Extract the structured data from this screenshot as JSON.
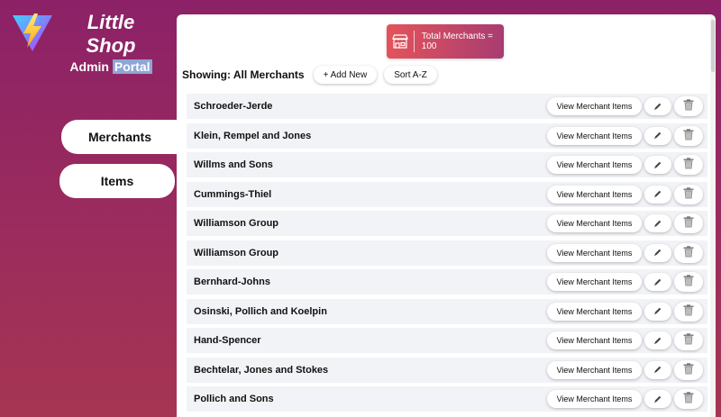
{
  "brand": {
    "title_line1": "Little",
    "title_line2": "Shop",
    "subtitle_part1": "Admin",
    "subtitle_part2": "Portal"
  },
  "nav": {
    "items": [
      {
        "label": "Merchants",
        "active": true
      },
      {
        "label": "Items",
        "active": false
      }
    ]
  },
  "stats": {
    "total_label": "Total Merchants = 100",
    "icon": "storefront-icon"
  },
  "toolbar": {
    "showing": "Showing: All Merchants",
    "add_label": "+ Add New",
    "sort_label": "Sort A-Z"
  },
  "merchants": [
    {
      "name": "Schroeder-Jerde",
      "view_label": "View Merchant Items"
    },
    {
      "name": "Klein, Rempel and Jones",
      "view_label": "View Merchant Items"
    },
    {
      "name": "Willms and Sons",
      "view_label": "View Merchant Items"
    },
    {
      "name": "Cummings-Thiel",
      "view_label": "View Merchant Items"
    },
    {
      "name": "Williamson Group",
      "view_label": "View Merchant Items"
    },
    {
      "name": "Williamson Group",
      "view_label": "View Merchant Items"
    },
    {
      "name": "Bernhard-Johns",
      "view_label": "View Merchant Items"
    },
    {
      "name": "Osinski, Pollich and Koelpin",
      "view_label": "View Merchant Items"
    },
    {
      "name": "Hand-Spencer",
      "view_label": "View Merchant Items"
    },
    {
      "name": "Bechtelar, Jones and Stokes",
      "view_label": "View Merchant Items"
    },
    {
      "name": "Pollich and Sons",
      "view_label": "View Merchant Items"
    }
  ],
  "colors": {
    "brand_gradient_start": "#8c2167",
    "brand_gradient_end": "#a63552",
    "stat_start": "#e4535a",
    "stat_end": "#a83c72"
  }
}
